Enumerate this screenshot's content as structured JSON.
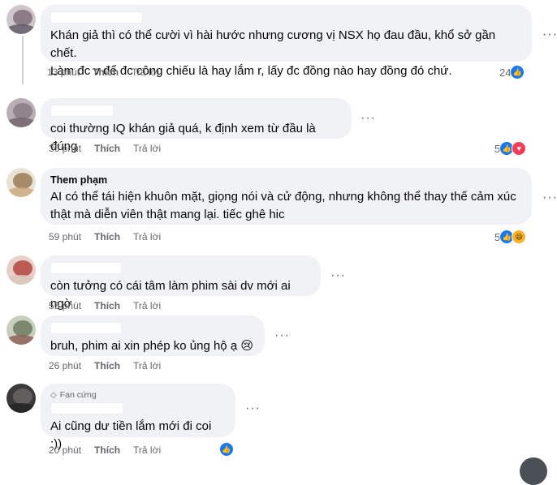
{
  "comments": [
    {
      "author": "",
      "text": "Khán giả thì có thể cười vì hài hước nhưng cương vị NSX họ đau đầu, khổ sở gần chết.\nLàm đc v để đc công chiếu là hay lắm r, lấy đc đồng nào hay đồng đó chứ.",
      "time": "13 phút",
      "like": "Thích",
      "reply": "Trả lời",
      "reaction_count": "24",
      "reactions": [
        "like"
      ]
    },
    {
      "author": "",
      "text": "coi thường IQ khán giả quá, k định xem từ đầu là đúng",
      "time": "36 phút",
      "like": "Thích",
      "reply": "Trả lời",
      "reaction_count": "5",
      "reactions": [
        "like",
        "love"
      ]
    },
    {
      "author": "Them phạm",
      "text": "AI có thể tái hiện khuôn mặt, giọng nói và cử động, nhưng không thể thay thế cảm xúc\nthật mà diễn viên thật mang lại. tiếc ghê hic",
      "time": "59 phút",
      "like": "Thích",
      "reply": "Trả lời",
      "reaction_count": "5",
      "reactions": [
        "like",
        "haha"
      ]
    },
    {
      "author": "",
      "text": "còn tưởng có cái tâm làm phim sài dv mới ai ngờ",
      "time": "55 phút",
      "like": "Thích",
      "reply": "Trả lời",
      "reaction_count": "",
      "reactions": []
    },
    {
      "author": "",
      "text": "bruh, phim ai xin phép ko ủng hộ ạ 😢",
      "time": "26 phút",
      "like": "Thích",
      "reply": "Trả lời",
      "reaction_count": "",
      "reactions": []
    },
    {
      "author": "",
      "badge": "Fan cứng",
      "text": "Ai cũng dư tiền lắm mới đi coi :))",
      "time": "20 phút",
      "like": "Thích",
      "reply": "Trả lời",
      "reaction_count": "",
      "reactions": [
        "like"
      ]
    }
  ],
  "more_glyph": "···",
  "colors": {
    "bubble": "#f0f2f5",
    "meta": "#65676b",
    "like": "#1877f2",
    "love": "#f33e58",
    "haha": "#f7b125"
  }
}
